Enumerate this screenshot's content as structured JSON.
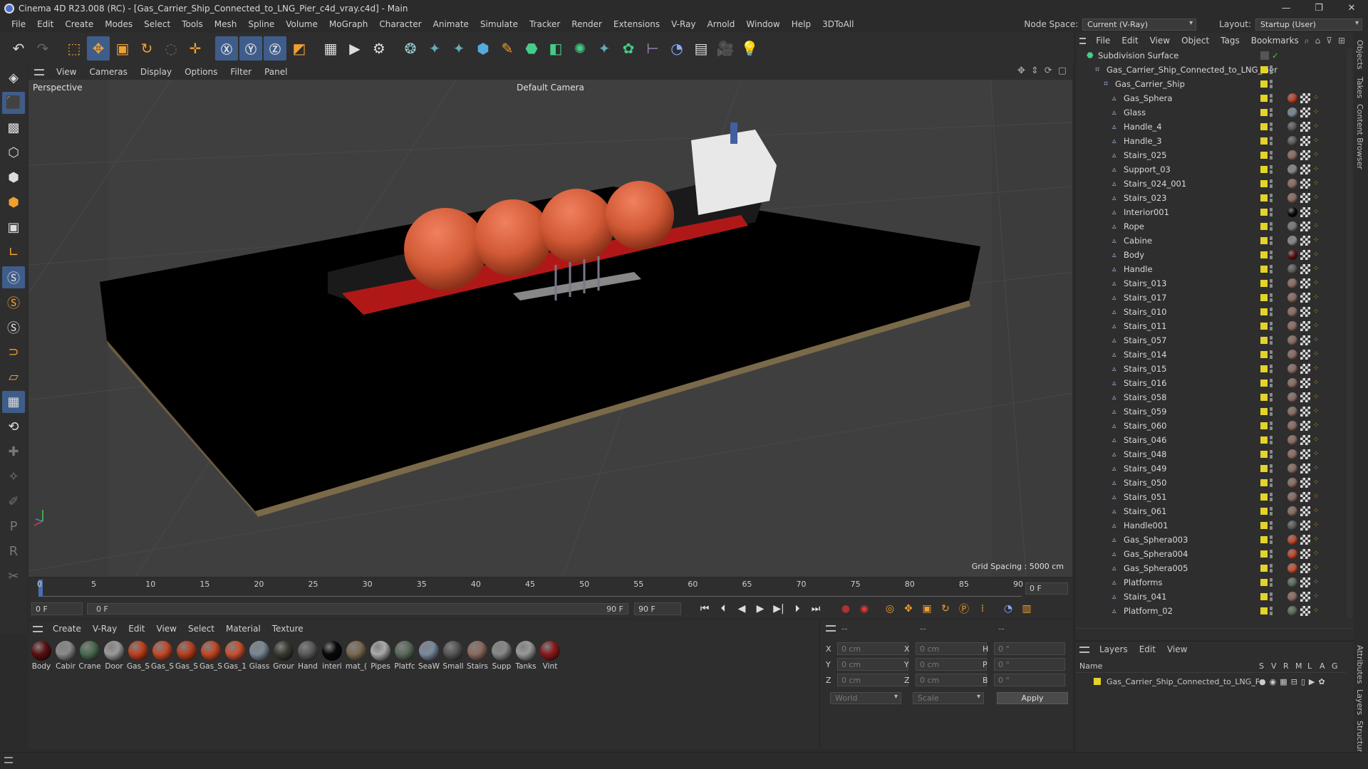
{
  "window": {
    "title": "Cinema 4D R23.008 (RC) - [Gas_Carrier_Ship_Connected_to_LNG_Pier_c4d_vray.c4d] - Main"
  },
  "menu": [
    "File",
    "Edit",
    "Create",
    "Modes",
    "Select",
    "Tools",
    "Mesh",
    "Spline",
    "Volume",
    "MoGraph",
    "Character",
    "Animate",
    "Simulate",
    "Tracker",
    "Render",
    "Extensions",
    "V-Ray",
    "Arnold",
    "Window",
    "Help",
    "3DToAll"
  ],
  "nodespace": {
    "label": "Node Space:",
    "value": "Current (V-Ray)"
  },
  "layout": {
    "label": "Layout:",
    "value": "Startup (User)"
  },
  "viewport": {
    "menu": [
      "View",
      "Cameras",
      "Display",
      "Options",
      "Filter",
      "Panel"
    ],
    "label": "Perspective",
    "camera": "Default Camera",
    "grid_spacing": "Grid Spacing : 5000 cm"
  },
  "timeline": {
    "ticks": [
      "0",
      "5",
      "10",
      "15",
      "20",
      "25",
      "30",
      "35",
      "40",
      "45",
      "50",
      "55",
      "60",
      "65",
      "70",
      "75",
      "80",
      "85",
      "90"
    ],
    "current_frame": "0 F",
    "start_field": "0 F",
    "range_start": "0 F",
    "range_end": "90 F",
    "end_field": "90 F"
  },
  "materials": {
    "menu": [
      "Create",
      "V-Ray",
      "Edit",
      "View",
      "Select",
      "Material",
      "Texture"
    ],
    "items": [
      {
        "label": "Body",
        "color": "#5a1010"
      },
      {
        "label": "Cabir",
        "color": "#8a8a8a"
      },
      {
        "label": "Crane",
        "color": "#4a6a50"
      },
      {
        "label": "Door",
        "color": "#9a9a9a"
      },
      {
        "label": "Gas_S",
        "color": "#c04020"
      },
      {
        "label": "Gas_S",
        "color": "#c44a28"
      },
      {
        "label": "Gas_S",
        "color": "#b84020"
      },
      {
        "label": "Gas_S",
        "color": "#c24826"
      },
      {
        "label": "Gas_1",
        "color": "#c85030"
      },
      {
        "label": "Glass",
        "color": "#7a8898"
      },
      {
        "label": "Grour",
        "color": "#3a3a30"
      },
      {
        "label": "Hand",
        "color": "#5a5a5a"
      },
      {
        "label": "interi",
        "color": "#080808"
      },
      {
        "label": "mat_(",
        "color": "#7a6a50"
      },
      {
        "label": "Pipes",
        "color": "#aaaaaa"
      },
      {
        "label": "Platfc",
        "color": "#5a6a5a"
      },
      {
        "label": "SeaW",
        "color": "#7a8aa0"
      },
      {
        "label": "Small",
        "color": "#555555"
      },
      {
        "label": "Stairs",
        "color": "#8a6a60"
      },
      {
        "label": "Supp",
        "color": "#888888"
      },
      {
        "label": "Tanks",
        "color": "#999999"
      },
      {
        "label": "Vint",
        "color": "#8a1a1a"
      }
    ]
  },
  "coords": {
    "header": [
      "--",
      "--",
      "--"
    ],
    "rows": [
      {
        "a": "X",
        "av": "0 cm",
        "b": "X",
        "bv": "0 cm",
        "c": "H",
        "cv": "0 °"
      },
      {
        "a": "Y",
        "av": "0 cm",
        "b": "Y",
        "bv": "0 cm",
        "c": "P",
        "cv": "0 °"
      },
      {
        "a": "Z",
        "av": "0 cm",
        "b": "Z",
        "bv": "0 cm",
        "c": "B",
        "cv": "0 °"
      }
    ],
    "space": "World",
    "mode": "Scale",
    "apply": "Apply"
  },
  "objects": {
    "menu": [
      "File",
      "Edit",
      "View",
      "Object",
      "Tags",
      "Bookmarks"
    ],
    "root": "Subdivision Surface",
    "l1": "Gas_Carrier_Ship_Connected_to_LNG_Pier",
    "l2": "Gas_Carrier_Ship",
    "children": [
      {
        "name": "Gas_Sphera",
        "mat": "#c04020"
      },
      {
        "name": "Glass",
        "mat": "#7a8898"
      },
      {
        "name": "Handle_4",
        "mat": "#5a5a5a"
      },
      {
        "name": "Handle_3",
        "mat": "#5a5a5a"
      },
      {
        "name": "Stairs_025",
        "mat": "#8a6a60"
      },
      {
        "name": "Support_03",
        "mat": "#888888"
      },
      {
        "name": "Stairs_024_001",
        "mat": "#8a6a60"
      },
      {
        "name": "Stairs_023",
        "mat": "#8a6a60"
      },
      {
        "name": "Interior001",
        "mat": "#080808"
      },
      {
        "name": "Rope",
        "mat": "#777777"
      },
      {
        "name": "Cabine",
        "mat": "#8a8a8a"
      },
      {
        "name": "Body",
        "mat": "#5a1010"
      },
      {
        "name": "Handle",
        "mat": "#5a5a5a"
      },
      {
        "name": "Stairs_013",
        "mat": "#8a6a60"
      },
      {
        "name": "Stairs_017",
        "mat": "#8a6a60"
      },
      {
        "name": "Stairs_010",
        "mat": "#8a6a60"
      },
      {
        "name": "Stairs_011",
        "mat": "#8a6a60"
      },
      {
        "name": "Stairs_057",
        "mat": "#8a6a60"
      },
      {
        "name": "Stairs_014",
        "mat": "#8a6a60"
      },
      {
        "name": "Stairs_015",
        "mat": "#8a6a60"
      },
      {
        "name": "Stairs_016",
        "mat": "#8a6a60"
      },
      {
        "name": "Stairs_058",
        "mat": "#8a6a60"
      },
      {
        "name": "Stairs_059",
        "mat": "#8a6a60"
      },
      {
        "name": "Stairs_060",
        "mat": "#8a6a60"
      },
      {
        "name": "Stairs_046",
        "mat": "#8a6a60"
      },
      {
        "name": "Stairs_048",
        "mat": "#8a6a60"
      },
      {
        "name": "Stairs_049",
        "mat": "#8a6a60"
      },
      {
        "name": "Stairs_050",
        "mat": "#8a6a60"
      },
      {
        "name": "Stairs_051",
        "mat": "#8a6a60"
      },
      {
        "name": "Stairs_061",
        "mat": "#8a6a60"
      },
      {
        "name": "Handle001",
        "mat": "#5a5a5a"
      },
      {
        "name": "Gas_Sphera003",
        "mat": "#c44a28"
      },
      {
        "name": "Gas_Sphera004",
        "mat": "#c24826"
      },
      {
        "name": "Gas_Sphera005",
        "mat": "#c85030"
      },
      {
        "name": "Platforms",
        "mat": "#5a6a5a"
      },
      {
        "name": "Stairs_041",
        "mat": "#8a6a60"
      },
      {
        "name": "Platform_02",
        "mat": "#5a6a5a"
      }
    ]
  },
  "layers": {
    "menu": [
      "Layers",
      "Edit",
      "View"
    ],
    "col_name": "Name",
    "cols": [
      "S",
      "V",
      "R",
      "M",
      "L",
      "A",
      "G"
    ],
    "row": "Gas_Carrier_Ship_Connected_to_LNG_Pier"
  },
  "sidetabs": [
    "Objects",
    "Takes",
    "Content Browser",
    "Attributes",
    "Layers",
    "Structure"
  ]
}
